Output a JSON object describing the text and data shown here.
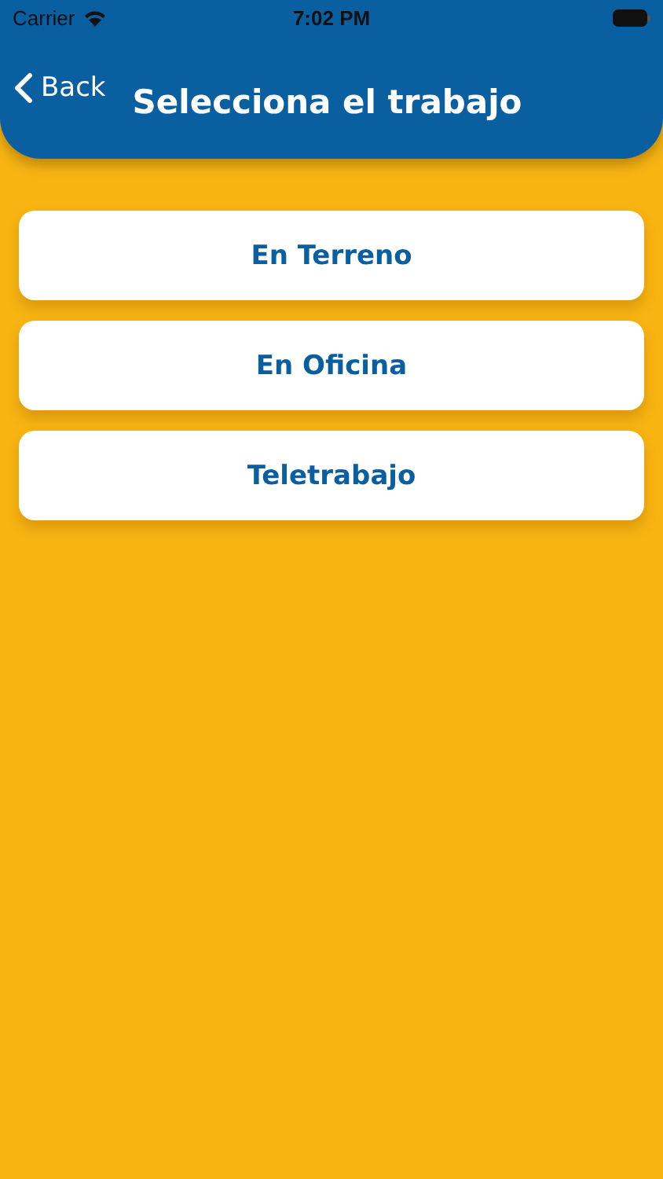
{
  "status_bar": {
    "carrier": "Carrier",
    "time": "7:02 PM"
  },
  "header": {
    "back": "Back",
    "title": "Selecciona el trabajo"
  },
  "options": [
    {
      "label": "En Terreno"
    },
    {
      "label": "En Oficina"
    },
    {
      "label": "Teletrabajo"
    }
  ]
}
